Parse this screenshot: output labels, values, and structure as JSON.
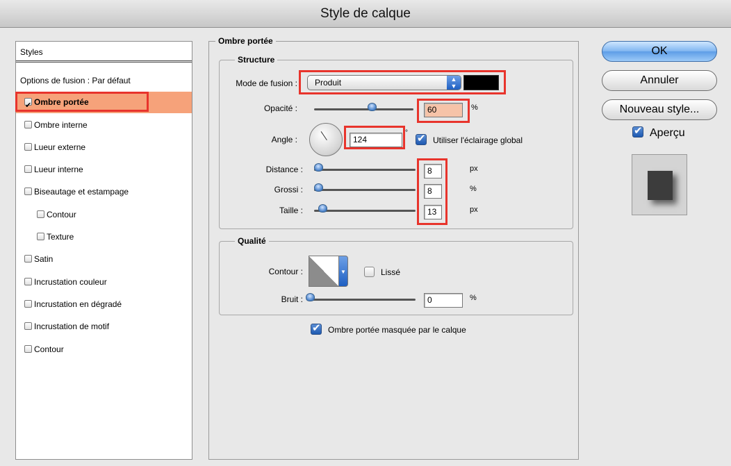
{
  "window": {
    "title": "Style de calque"
  },
  "styles_panel": {
    "header": "Styles",
    "items": [
      {
        "label": "Options de fusion : Par défaut",
        "checkbox": false,
        "checked": false
      },
      {
        "label": "Ombre portée",
        "checkbox": true,
        "checked": true,
        "selected": true
      },
      {
        "label": "Ombre interne",
        "checkbox": true,
        "checked": false
      },
      {
        "label": "Lueur externe",
        "checkbox": true,
        "checked": false
      },
      {
        "label": "Lueur interne",
        "checkbox": true,
        "checked": false
      },
      {
        "label": "Biseautage et estampage",
        "checkbox": true,
        "checked": false
      },
      {
        "label": "Contour",
        "checkbox": true,
        "checked": false,
        "sub": true
      },
      {
        "label": "Texture",
        "checkbox": true,
        "checked": false,
        "sub": true
      },
      {
        "label": "Satin",
        "checkbox": true,
        "checked": false
      },
      {
        "label": "Incrustation couleur",
        "checkbox": true,
        "checked": false
      },
      {
        "label": "Incrustation en dégradé",
        "checkbox": true,
        "checked": false
      },
      {
        "label": "Incrustation de motif",
        "checkbox": true,
        "checked": false
      },
      {
        "label": "Contour",
        "checkbox": true,
        "checked": false
      }
    ]
  },
  "drop_shadow": {
    "section_title": "Ombre portée",
    "structure": {
      "legend": "Structure",
      "blend_mode_label": "Mode de fusion :",
      "blend_mode_value": "Produit",
      "shadow_color": "#000000",
      "opacity_label": "Opacité :",
      "opacity_value": "60",
      "opacity_unit": "%",
      "angle_label": "Angle :",
      "angle_value": "124",
      "angle_unit": "°",
      "global_light_label": "Utiliser l'éclairage global",
      "global_light_checked": true,
      "distance_label": "Distance :",
      "distance_value": "8",
      "distance_unit": "px",
      "spread_label": "Grossi :",
      "spread_value": "8",
      "spread_unit": "%",
      "size_label": "Taille :",
      "size_value": "13",
      "size_unit": "px"
    },
    "quality": {
      "legend": "Qualité",
      "contour_label": "Contour :",
      "antialias_label": "Lissé",
      "antialias_checked": false,
      "noise_label": "Bruit :",
      "noise_value": "0",
      "noise_unit": "%"
    },
    "knockout_label": "Ombre portée masquée par le calque",
    "knockout_checked": true
  },
  "buttons": {
    "ok": "OK",
    "cancel": "Annuler",
    "new_style": "Nouveau style..."
  },
  "preview": {
    "label": "Aperçu",
    "checked": true
  },
  "accent_colors": {
    "highlight_red": "#e8342c",
    "selected_row": "#f6a27a",
    "accent_blue": "#2f6cc4"
  }
}
